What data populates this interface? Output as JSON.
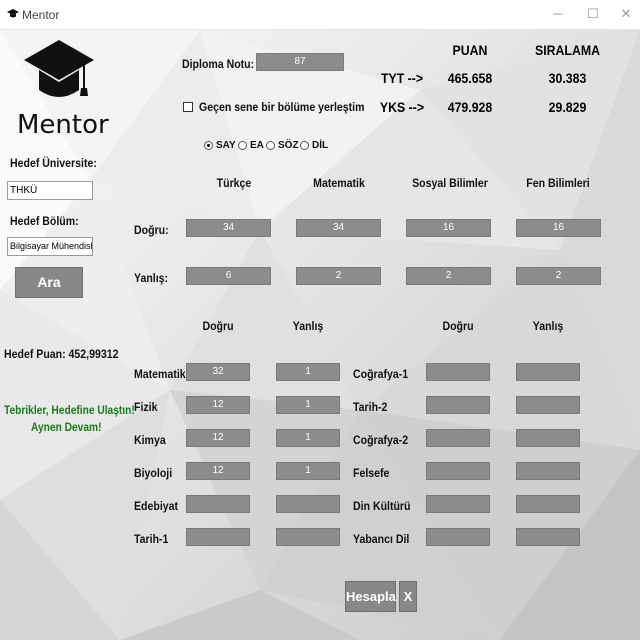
{
  "window": {
    "title": "Mentor",
    "minimize": "─",
    "maximize": "☐",
    "close": "✕"
  },
  "brand": {
    "name": "Mentor",
    "icon": "graduation-cap-icon"
  },
  "left": {
    "hedef_universite_label": "Hedef Üniversite:",
    "hedef_universite_value": "THKÜ",
    "hedef_bolum_label": "Hedef Bölüm:",
    "hedef_bolum_value": "Bilgisayar Mühendisliği",
    "ara_button": "Ara",
    "hedef_puan": "Hedef Puan: 452,99312",
    "congrats_line1": "Tebrikler, Hedefine Ulaştın!",
    "congrats_line2": "Aynen Devam!",
    "congrats_color": "#1a7a1a"
  },
  "top": {
    "diploma_label": "Diploma Notu:",
    "diploma_value": "87",
    "checkbox_label": "Geçen sene bir bölüme yerleştim",
    "radios": [
      {
        "label": "SAY",
        "checked": true
      },
      {
        "label": "EA",
        "checked": false
      },
      {
        "label": "SÖZ",
        "checked": false
      },
      {
        "label": "DİL",
        "checked": false
      }
    ]
  },
  "results": {
    "puan_header": "PUAN",
    "siralama_header": "SIRALAMA",
    "rows": [
      {
        "label": "TYT -->",
        "puan": "465.658",
        "siralama": "30.383"
      },
      {
        "label": "YKS -->",
        "puan": "479.928",
        "siralama": "29.829"
      }
    ]
  },
  "tyt": {
    "headers": [
      "Türkçe",
      "Matematik",
      "Sosyal Bilimler",
      "Fen Bilimleri"
    ],
    "dogru_label": "Doğru:",
    "yanlis_label": "Yanlış:",
    "dogru": [
      "34",
      "34",
      "16",
      "16"
    ],
    "yanlis": [
      "6",
      "2",
      "2",
      "2"
    ]
  },
  "ayt": {
    "dogru_header": "Doğru",
    "yanlis_header": "Yanlış",
    "left_subjects": [
      {
        "name": "Matematik",
        "dogru": "32",
        "yanlis": "1"
      },
      {
        "name": "Fizik",
        "dogru": "12",
        "yanlis": "1"
      },
      {
        "name": "Kimya",
        "dogru": "12",
        "yanlis": "1"
      },
      {
        "name": "Biyoloji",
        "dogru": "12",
        "yanlis": "1"
      },
      {
        "name": "Edebiyat",
        "dogru": "",
        "yanlis": ""
      },
      {
        "name": "Tarih-1",
        "dogru": "",
        "yanlis": ""
      }
    ],
    "right_subjects": [
      {
        "name": "Coğrafya-1",
        "dogru": "",
        "yanlis": ""
      },
      {
        "name": "Tarih-2",
        "dogru": "",
        "yanlis": ""
      },
      {
        "name": "Coğrafya-2",
        "dogru": "",
        "yanlis": ""
      },
      {
        "name": "Felsefe",
        "dogru": "",
        "yanlis": ""
      },
      {
        "name": "Din Kültürü",
        "dogru": "",
        "yanlis": ""
      },
      {
        "name": "Yabancı Dil",
        "dogru": "",
        "yanlis": ""
      }
    ]
  },
  "actions": {
    "hesapla": "Hesapla",
    "close": "X"
  }
}
